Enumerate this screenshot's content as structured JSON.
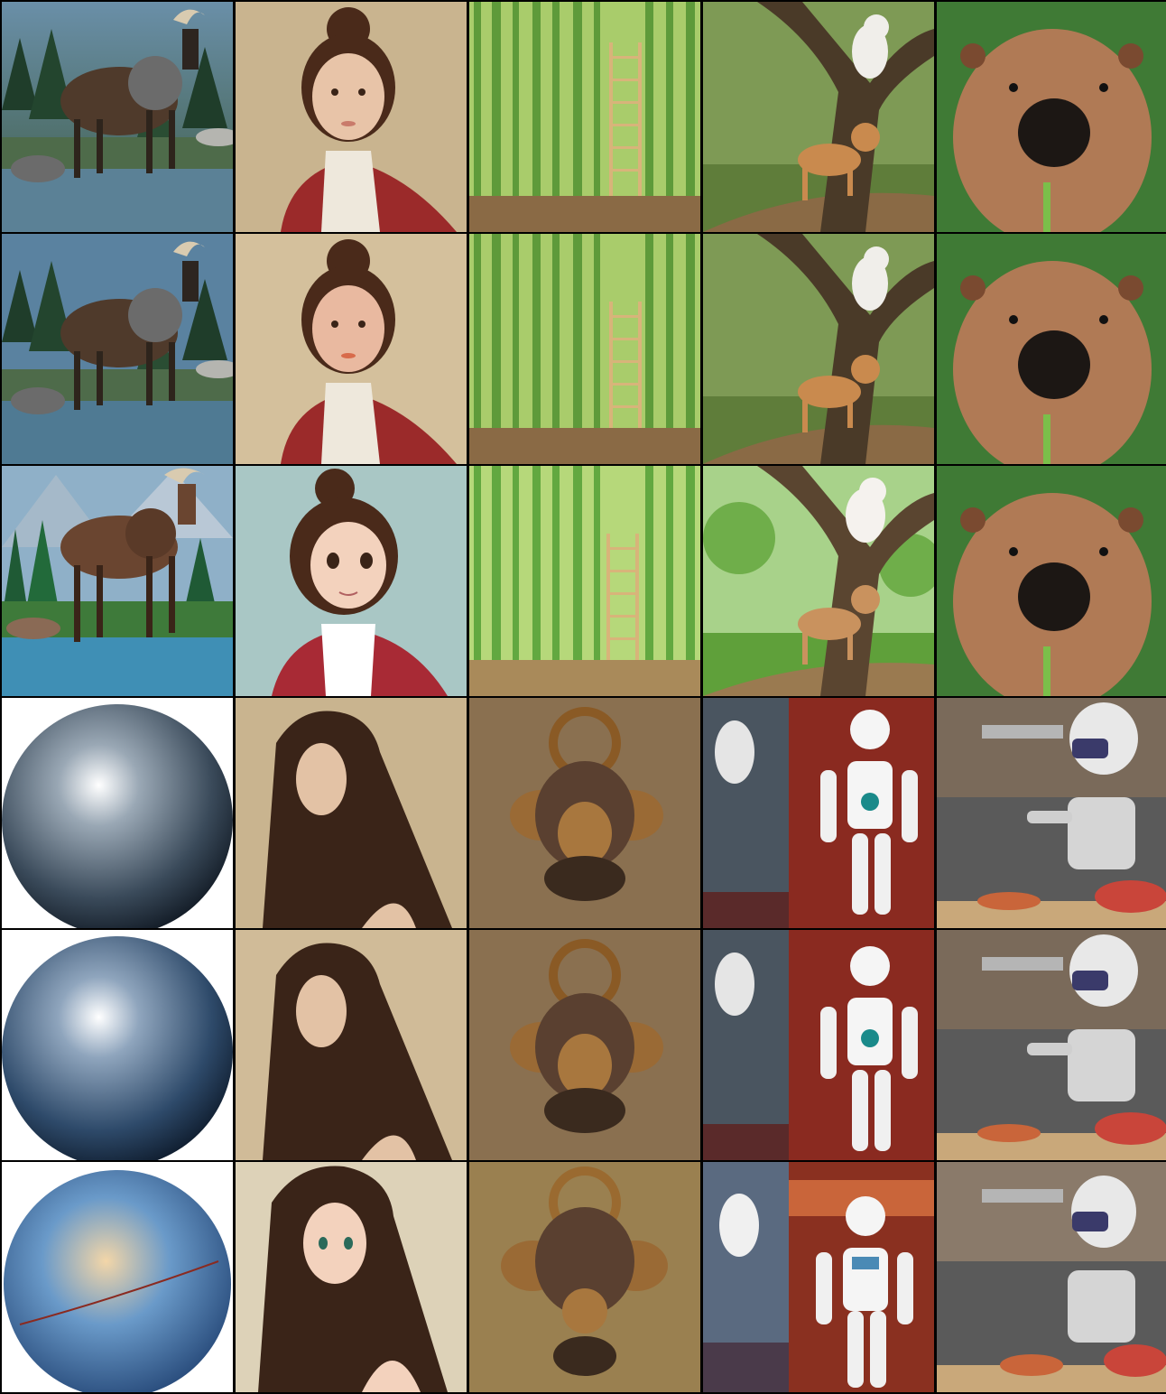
{
  "grid": {
    "rows": 6,
    "columns": 5,
    "cells": [
      [
        "moose",
        "girl-portrait",
        "bamboo-ladder",
        "cats-tree",
        "capybara"
      ],
      [
        "moose",
        "girl-portrait",
        "bamboo-ladder",
        "cats-tree",
        "capybara"
      ],
      [
        "moose-stylized",
        "girl-anime",
        "bamboo-ladder",
        "cats-tree-stylized",
        "capybara"
      ],
      [
        "sphere",
        "woman-long-hair",
        "door-knocker",
        "robot-soccer",
        "robot-kitchen"
      ],
      [
        "sphere",
        "woman-long-hair",
        "door-knocker",
        "robot-soccer",
        "robot-kitchen"
      ],
      [
        "globe-painted",
        "woman-anime",
        "door-knocker",
        "robot-soccer-stylized",
        "robot-kitchen"
      ]
    ]
  }
}
